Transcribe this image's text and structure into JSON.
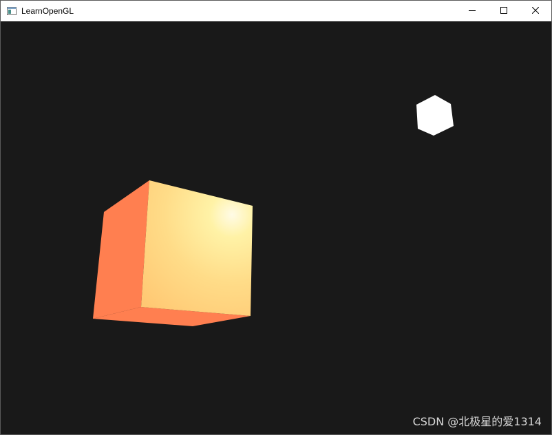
{
  "window": {
    "title": "LearnOpenGL",
    "icon": "app-window-icon",
    "buttons": {
      "minimize": "minimize-icon",
      "maximize": "maximize-icon",
      "close": "close-icon"
    }
  },
  "scene": {
    "background_color": "#191919",
    "lit_cube": {
      "side_color": "#ff7f50",
      "front_color": "#ffd07a",
      "highlight_color": "#fffbe0"
    },
    "light_cube": {
      "color": "#ffffff"
    }
  },
  "watermark": {
    "text": "CSDN @北极星的爱1314"
  }
}
